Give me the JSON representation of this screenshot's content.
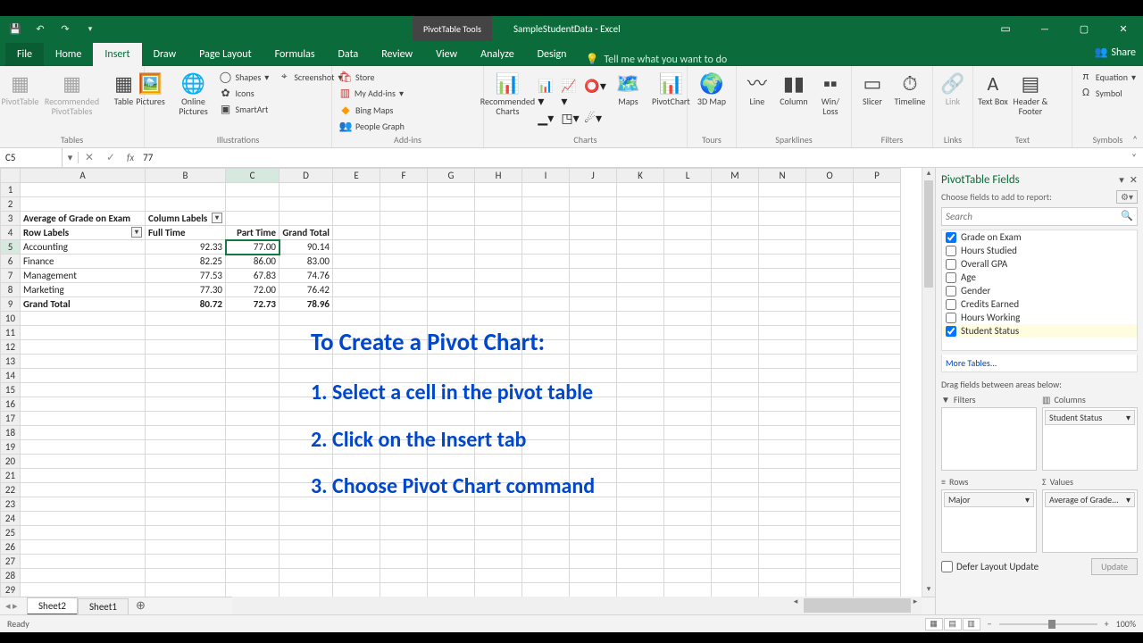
{
  "titlebar": {
    "context_tab": "PivotTable Tools",
    "doc_title": "SampleStudentData - Excel"
  },
  "tabs": {
    "file": "File",
    "items": [
      "Home",
      "Insert",
      "Draw",
      "Page Layout",
      "Formulas",
      "Data",
      "Review",
      "View",
      "Analyze",
      "Design"
    ],
    "active_index": 1,
    "tell_me": "Tell me what you want to do",
    "share": "Share"
  },
  "ribbon": {
    "groups": {
      "tables": {
        "label": "Tables",
        "pivot": "PivotTable",
        "recommended": "Recommended PivotTables",
        "table": "Table"
      },
      "illustrations": {
        "label": "Illustrations",
        "pictures": "Pictures",
        "online": "Online Pictures",
        "shapes": "Shapes",
        "icons": "Icons",
        "smartart": "SmartArt",
        "screenshot": "Screenshot"
      },
      "addins": {
        "label": "Add-ins",
        "store": "Store",
        "myaddins": "My Add-ins",
        "bing": "Bing Maps",
        "people": "People Graph"
      },
      "charts": {
        "label": "Charts",
        "recommended": "Recommended Charts",
        "maps": "Maps",
        "pivotchart": "PivotChart"
      },
      "tours": {
        "label": "Tours",
        "map3d": "3D Map"
      },
      "sparklines": {
        "label": "Sparklines",
        "line": "Line",
        "column": "Column",
        "winloss": "Win/ Loss"
      },
      "filters": {
        "label": "Filters",
        "slicer": "Slicer",
        "timeline": "Timeline"
      },
      "links": {
        "label": "Links",
        "link": "Link"
      },
      "text_g": {
        "label": "Text",
        "textbox": "Text Box",
        "headerfooter": "Header & Footer"
      },
      "symbols": {
        "label": "Symbols",
        "equation": "Equation",
        "symbol": "Symbol"
      }
    }
  },
  "fbar": {
    "name": "C5",
    "value": "77"
  },
  "columns": [
    "A",
    "B",
    "C",
    "D",
    "E",
    "F",
    "G",
    "H",
    "I",
    "J",
    "K",
    "L",
    "M",
    "N",
    "O",
    "P"
  ],
  "pivot": {
    "title": "Average of Grade on Exam",
    "col_label_hdr": "Column Labels",
    "row_label_hdr": "Row Labels",
    "cols": [
      "Full Time",
      "Part Time",
      "Grand Total"
    ],
    "rows": [
      {
        "label": "Accounting",
        "vals": [
          "92.33",
          "77.00",
          "90.14"
        ]
      },
      {
        "label": "Finance",
        "vals": [
          "82.25",
          "86.00",
          "83.00"
        ]
      },
      {
        "label": "Management",
        "vals": [
          "77.53",
          "67.83",
          "74.76"
        ]
      },
      {
        "label": "Marketing",
        "vals": [
          "77.30",
          "72.00",
          "76.42"
        ]
      }
    ],
    "total": {
      "label": "Grand Total",
      "vals": [
        "80.72",
        "72.73",
        "78.96"
      ]
    }
  },
  "overlay": {
    "title": "To Create a Pivot Chart:",
    "l1": "1. Select a cell in the pivot table",
    "l2": "2. Click on the Insert tab",
    "l3": "3. Choose Pivot Chart command"
  },
  "sheet_tabs": {
    "active": "Sheet2",
    "other": "Sheet1"
  },
  "fields_pane": {
    "title": "PivotTable Fields",
    "subtitle": "Choose fields to add to report:",
    "search_ph": "Search",
    "fields": [
      {
        "name": "Grade on Exam",
        "checked": true
      },
      {
        "name": "Hours Studied",
        "checked": false
      },
      {
        "name": "Overall GPA",
        "checked": false
      },
      {
        "name": "Age",
        "checked": false
      },
      {
        "name": "Gender",
        "checked": false
      },
      {
        "name": "Credits Earned",
        "checked": false
      },
      {
        "name": "Hours Working",
        "checked": false
      },
      {
        "name": "Student Status",
        "checked": true
      }
    ],
    "more": "More Tables...",
    "drag_label": "Drag fields between areas below:",
    "filters_hdr": "Filters",
    "columns_hdr": "Columns",
    "rows_hdr": "Rows",
    "values_hdr": "Values",
    "col_item": "Student Status",
    "row_item": "Major",
    "val_item": "Average of Grade...",
    "defer": "Defer Layout Update",
    "update": "Update"
  },
  "statusbar": {
    "ready": "Ready",
    "zoom": "100%"
  }
}
